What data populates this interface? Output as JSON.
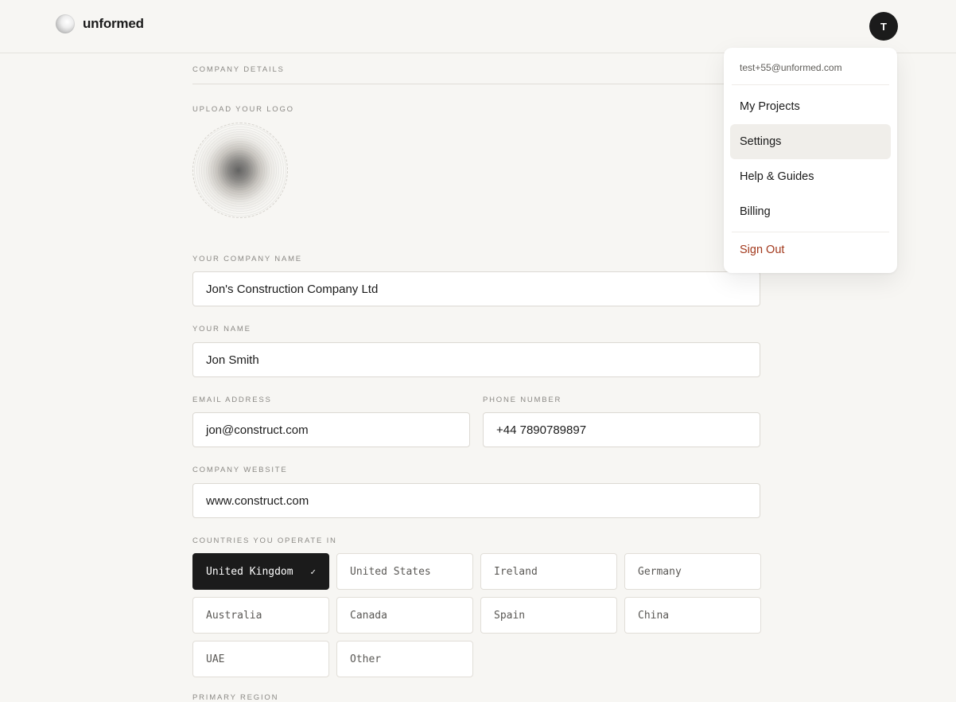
{
  "header": {
    "brand": "unformed",
    "avatar_initial": "T"
  },
  "form": {
    "section_title": "COMPANY DETAILS",
    "logo_label": "UPLOAD YOUR LOGO",
    "company_name": {
      "label": "YOUR COMPANY NAME",
      "value": "Jon's Construction Company Ltd"
    },
    "your_name": {
      "label": "YOUR NAME",
      "value": "Jon Smith"
    },
    "email": {
      "label": "EMAIL ADDRESS",
      "value": "jon@construct.com"
    },
    "phone": {
      "label": "PHONE NUMBER",
      "value": "+44 7890789897"
    },
    "website": {
      "label": "COMPANY WEBSITE",
      "value": "www.construct.com"
    },
    "countries_label": "COUNTRIES YOU OPERATE IN",
    "countries": [
      {
        "name": "United Kingdom",
        "selected": true
      },
      {
        "name": "United States",
        "selected": false
      },
      {
        "name": "Ireland",
        "selected": false
      },
      {
        "name": "Germany",
        "selected": false
      },
      {
        "name": "Australia",
        "selected": false
      },
      {
        "name": "Canada",
        "selected": false
      },
      {
        "name": "Spain",
        "selected": false
      },
      {
        "name": "China",
        "selected": false
      },
      {
        "name": "UAE",
        "selected": false
      },
      {
        "name": "Other",
        "selected": false
      }
    ],
    "check_mark": "✓",
    "next_label": "PRIMARY REGION"
  },
  "user_menu": {
    "email": "test+55@unformed.com",
    "items": [
      {
        "label": "My Projects"
      },
      {
        "label": "Settings",
        "active": true
      },
      {
        "label": "Help & Guides"
      },
      {
        "label": "Billing"
      }
    ],
    "sign_out": "Sign Out",
    "colors": {
      "danger": "#a33a1e",
      "active_bg": "#f0eeea"
    }
  }
}
